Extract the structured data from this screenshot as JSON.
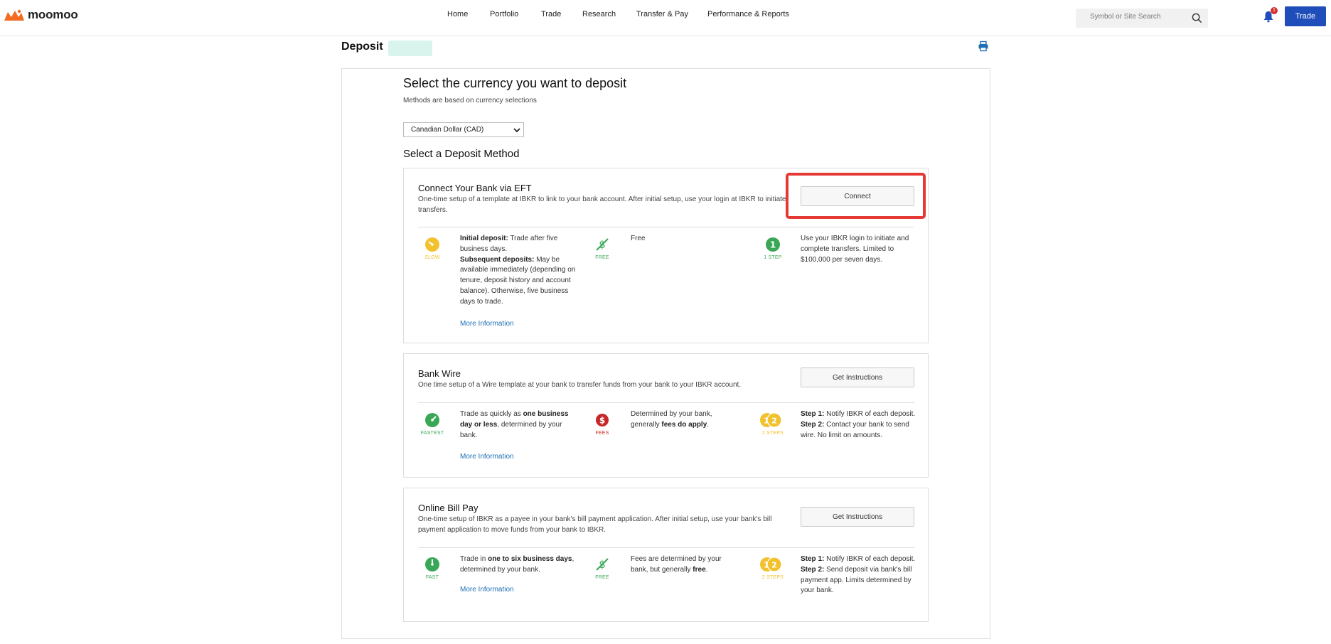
{
  "brand": {
    "name": "moomoo"
  },
  "nav": {
    "items": [
      "Home",
      "Portfolio",
      "Trade",
      "Research",
      "Transfer & Pay",
      "Performance & Reports"
    ]
  },
  "search": {
    "placeholder": "Symbol or Site Search"
  },
  "notifications": {
    "count": "1"
  },
  "header": {
    "trade_label": "Trade"
  },
  "page": {
    "title": "Deposit"
  },
  "currency": {
    "heading": "Select the currency you want to deposit",
    "subtext": "Methods are based on currency selections",
    "selected": "Canadian Dollar (CAD)"
  },
  "methods_heading": "Select a Deposit Method",
  "methods": [
    {
      "title": "Connect Your Bank via EFT",
      "description": "One-time setup of a template at IBKR to link to your bank account. After initial setup, use your login at IBKR to initiate transfers.",
      "button": "Connect",
      "speed": {
        "label": "SLOW",
        "initial_label": "Initial deposit:",
        "initial_text": " Trade after five business days.",
        "subsequent_label": "Subsequent deposits:",
        "subsequent_text": " May be available immediately (depending on tenure, deposit history and account balance). Otherwise, five business days to trade."
      },
      "cost": {
        "label": "FREE",
        "text": "Free"
      },
      "steps": {
        "label": "1 STEP",
        "text": "Use your IBKR login to initiate and complete transfers. Limited to $100,000 per seven days."
      },
      "more": "More Information"
    },
    {
      "title": "Bank Wire",
      "description": "One time setup of a Wire template at your bank to transfer funds from your bank to your IBKR account.",
      "button": "Get Instructions",
      "speed": {
        "label": "FASTEST",
        "pre": "Trade as quickly as ",
        "bold": "one business day or less",
        "post": ", determined by your bank."
      },
      "cost": {
        "label": "FEES",
        "pre": "Determined by your bank, generally ",
        "bold": "fees do apply",
        "post": "."
      },
      "steps": {
        "label": "2 STEPS",
        "step1_label": "Step 1:",
        "step1_text": " Notify IBKR of each deposit.",
        "step2_label": "Step 2:",
        "step2_text": " Contact your bank to send wire. No limit on amounts."
      },
      "more": "More Information"
    },
    {
      "title": "Online Bill Pay",
      "description": "One-time setup of IBKR as a payee in your bank's bill payment application. After initial setup, use your bank's bill payment application to move funds from your bank to IBKR.",
      "button": "Get Instructions",
      "speed": {
        "label": "FAST",
        "pre": "Trade in ",
        "bold": "one to six business days",
        "post": ", determined by your bank."
      },
      "cost": {
        "label": "FREE",
        "pre": "Fees are determined by your bank, but generally ",
        "bold": "free",
        "post": "."
      },
      "steps": {
        "label": "2 STEPS",
        "step1_label": "Step 1:",
        "step1_text": " Notify IBKR of each deposit.",
        "step2_label": "Step 2:",
        "step2_text": " Send deposit via bank's bill payment app. Limits determined by your bank."
      },
      "more": "More Information"
    }
  ],
  "colors": {
    "accent": "#1f4dba",
    "link": "#1f6fb5",
    "slow": "#f2c12e",
    "green": "#3aa757",
    "fee_red": "#c62828",
    "highlight": "#e53935",
    "logo_orange": "#f26b21"
  }
}
